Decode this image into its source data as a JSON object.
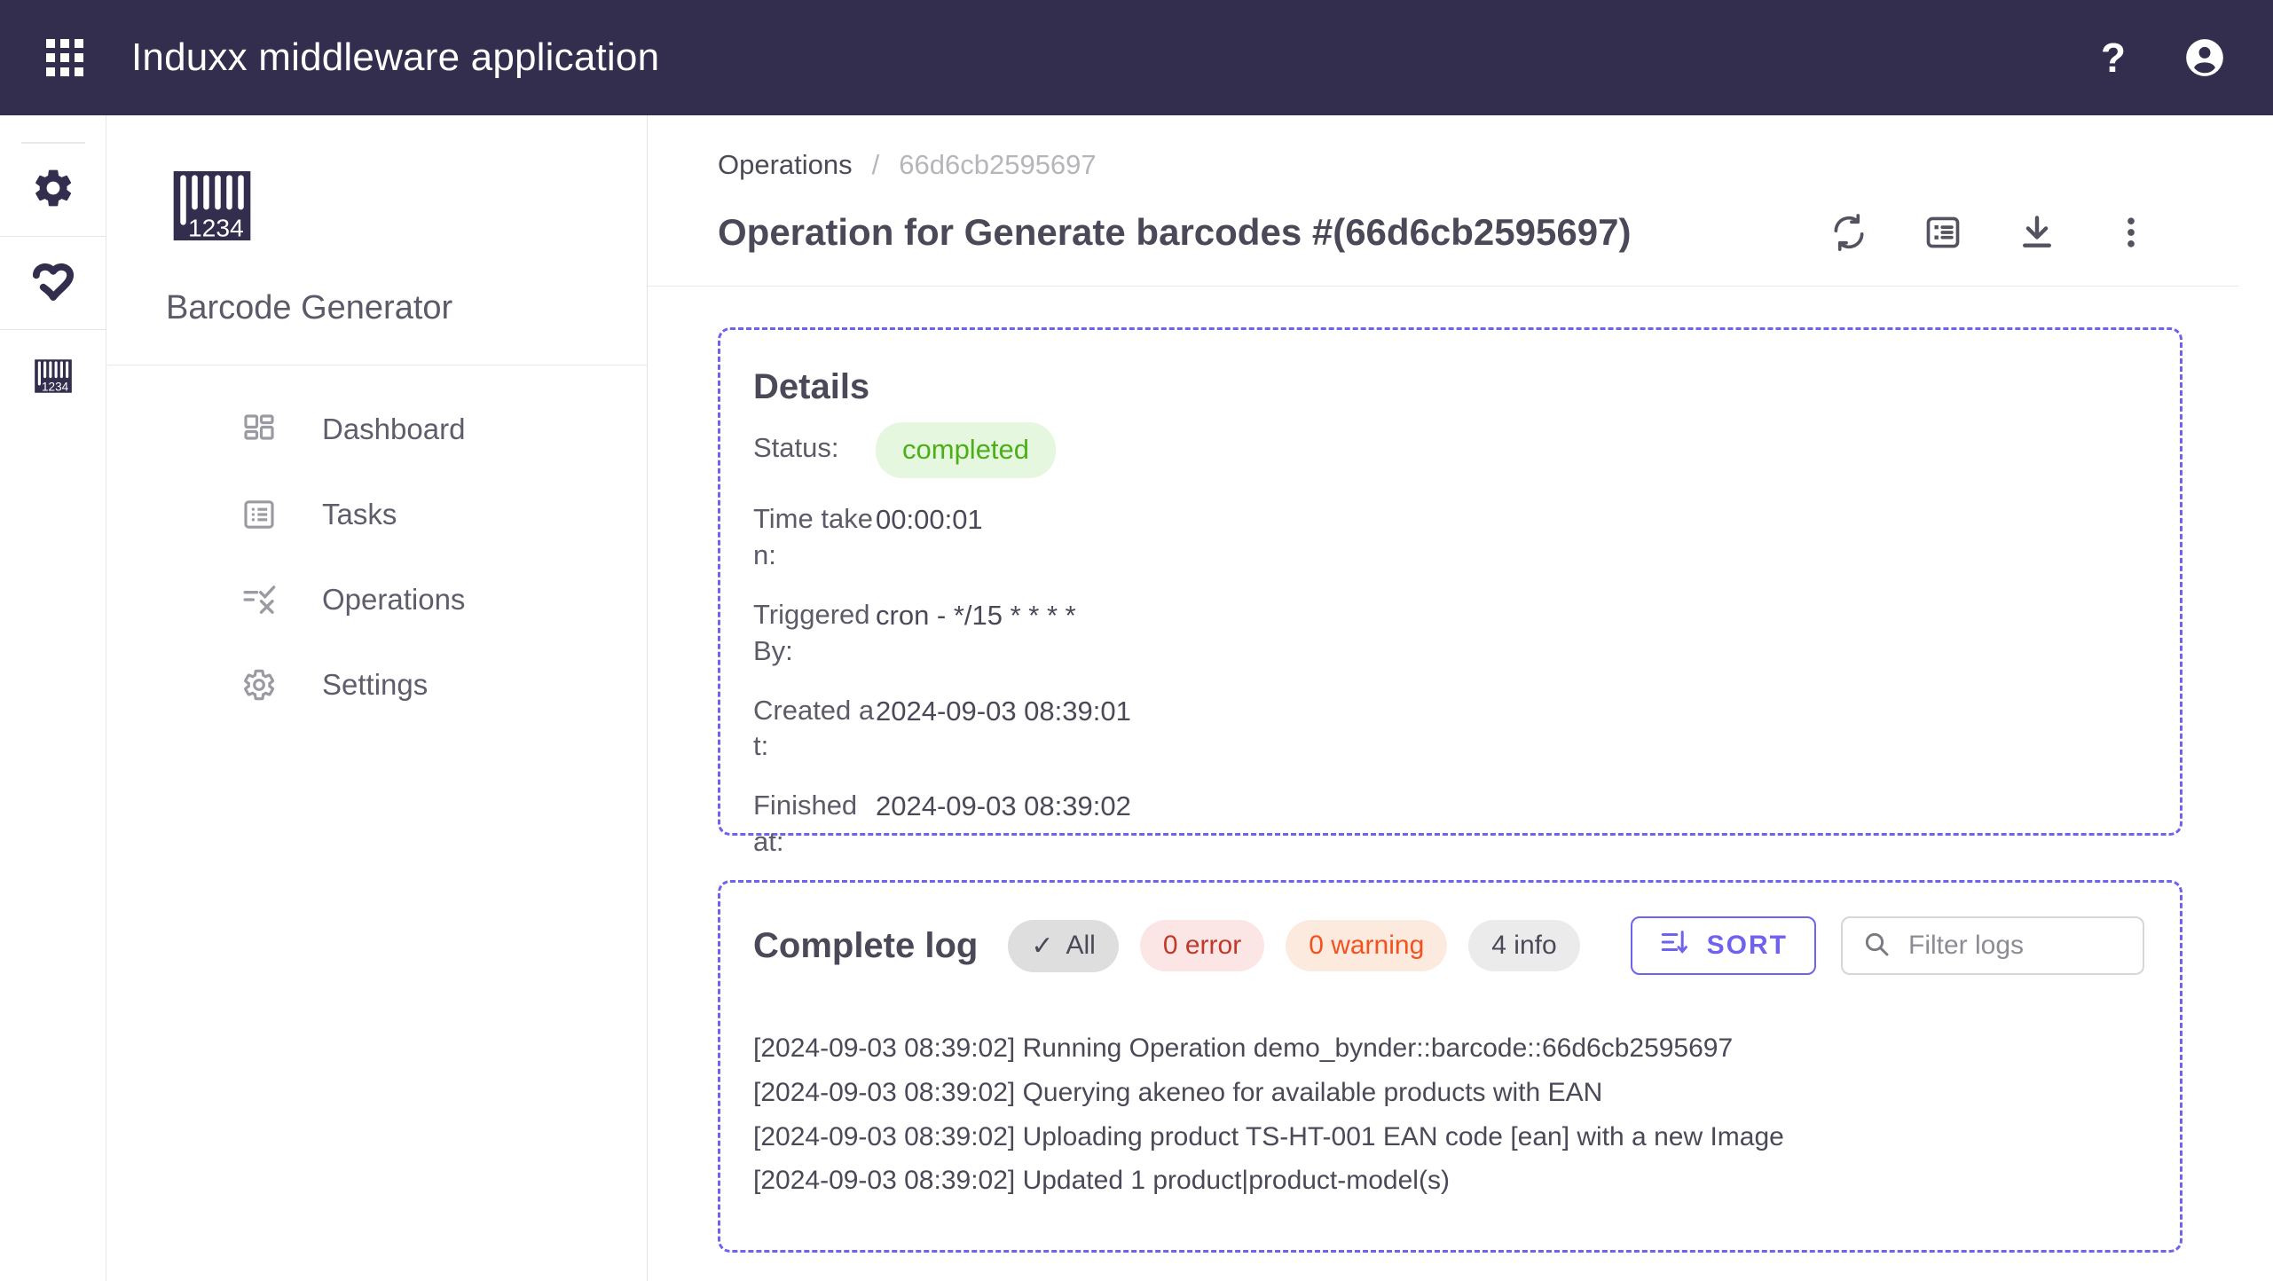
{
  "topbar": {
    "apps_icon": "apps-grid-icon",
    "title": "Induxx middleware application",
    "help_icon": "?",
    "help_icon_name": "help-icon",
    "avatar_icon_name": "account-circle-icon"
  },
  "rail": {
    "items": [
      {
        "icon": "gear-icon",
        "name": "settings"
      },
      {
        "icon": "akeneo-heart-icon",
        "name": "akeneo"
      },
      {
        "icon": "barcode-icon",
        "name": "barcode-generator"
      }
    ]
  },
  "sidebar": {
    "logo_icon": "barcode-1234-logo",
    "logo_digits": "1234",
    "app_name": "Barcode Generator",
    "items": [
      {
        "label": "Dashboard",
        "icon": "dashboard-grid-icon"
      },
      {
        "label": "Tasks",
        "icon": "list-box-icon"
      },
      {
        "label": "Operations",
        "icon": "check-cross-list-icon"
      },
      {
        "label": "Settings",
        "icon": "gear-icon"
      }
    ]
  },
  "breadcrumb": {
    "parent": "Operations",
    "separator": "/",
    "current": "66d6cb2595697"
  },
  "page": {
    "title": "Operation for Generate barcodes #(66d6cb2595697)",
    "actions": [
      {
        "name": "refresh-icon",
        "label": "sync"
      },
      {
        "name": "task-list-icon",
        "label": "tasks"
      },
      {
        "name": "download-icon",
        "label": "download"
      },
      {
        "name": "more-vertical-icon",
        "label": "more"
      }
    ]
  },
  "details": {
    "heading": "Details",
    "status_label": "Status:",
    "status_value": "completed",
    "rows": [
      {
        "label": "Time taken:",
        "value": "00:00:01"
      },
      {
        "label": "Triggered By:",
        "value": "cron - */15 * * * *"
      },
      {
        "label": "Created at:",
        "value": "2024-09-03 08:39:01"
      },
      {
        "label": "Finished at:",
        "value": "2024-09-03 08:39:02"
      }
    ]
  },
  "logs": {
    "heading": "Complete log",
    "chips": [
      {
        "label": "All",
        "icon": "check-icon",
        "style": "all"
      },
      {
        "label": "0 error",
        "style": "error"
      },
      {
        "label": "0 warning",
        "style": "warning"
      },
      {
        "label": "4 info",
        "style": "info"
      }
    ],
    "sort_label": "SORT",
    "sort_icon": "sort-descending-icon",
    "filter_placeholder": "Filter logs",
    "filter_value": "",
    "search_icon": "search-icon",
    "lines": [
      "[2024-09-03 08:39:02] Running Operation demo_bynder::barcode::66d6cb2595697",
      "[2024-09-03 08:39:02] Querying akeneo for available products with EAN",
      "[2024-09-03 08:39:02] Uploading product TS-HT-001 EAN code [ean] with a new Image",
      "[2024-09-03 08:39:02] Updated 1 product|product-model(s)"
    ]
  },
  "colors": {
    "topbar_bg": "#332e4e",
    "accent_purple": "#6f62ee",
    "status_green_text": "#4caf17",
    "status_green_bg": "#e6f7e0",
    "error_text": "#c0392b",
    "warning_text": "#f4511e"
  }
}
